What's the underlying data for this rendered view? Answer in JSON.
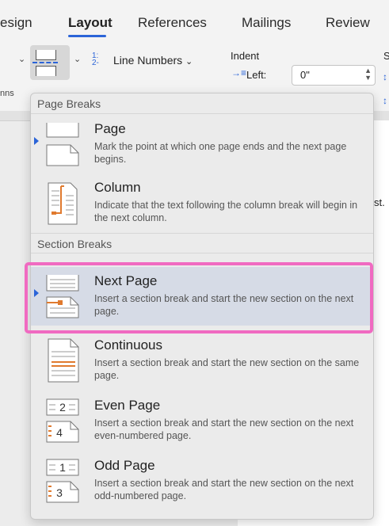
{
  "ribbon": {
    "tabs": [
      {
        "label": "esign"
      },
      {
        "label": "Layout",
        "active": true
      },
      {
        "label": "References"
      },
      {
        "label": "Mailings"
      },
      {
        "label": "Review"
      }
    ],
    "line_numbers_label": "Line Numbers",
    "line_numbers_icon": "1:\n2-",
    "indent_label": "Indent",
    "left_label": "Left:",
    "left_value": "0\"",
    "fragment_s": "S",
    "fragment_ns": "nns",
    "chevron": "⌄"
  },
  "document": {
    "fragment_text": "st."
  },
  "menu": {
    "page_breaks_header": "Page Breaks",
    "section_breaks_header": "Section Breaks",
    "page_breaks": [
      {
        "title": "Page",
        "desc": "Mark the point at which one page ends and the next page begins.",
        "icon": "page-break-icon"
      },
      {
        "title": "Column",
        "desc": "Indicate that the text following the column break will begin in the next column.",
        "icon": "column-break-icon"
      }
    ],
    "section_breaks": [
      {
        "title": "Next Page",
        "desc": "Insert a section break and start the new section on the next page.",
        "icon": "next-page-icon",
        "selected": true
      },
      {
        "title": "Continuous",
        "desc": "Insert a section break and start the new section on the same page.",
        "icon": "continuous-icon"
      },
      {
        "title": "Even Page",
        "desc": "Insert a section break and start the new section on the next even-numbered page.",
        "icon": "even-page-icon",
        "num_top": "2",
        "num_bottom": "4"
      },
      {
        "title": "Odd Page",
        "desc": "Insert a section break and start the new section on the next odd-numbered page.",
        "icon": "odd-page-icon",
        "num_top": "1",
        "num_bottom": "3"
      }
    ]
  },
  "colors": {
    "accent": "#2b64d8",
    "highlight": "#f06ac1",
    "selected_bg": "#d6dbe6",
    "icon_orange": "#e07a2e"
  }
}
